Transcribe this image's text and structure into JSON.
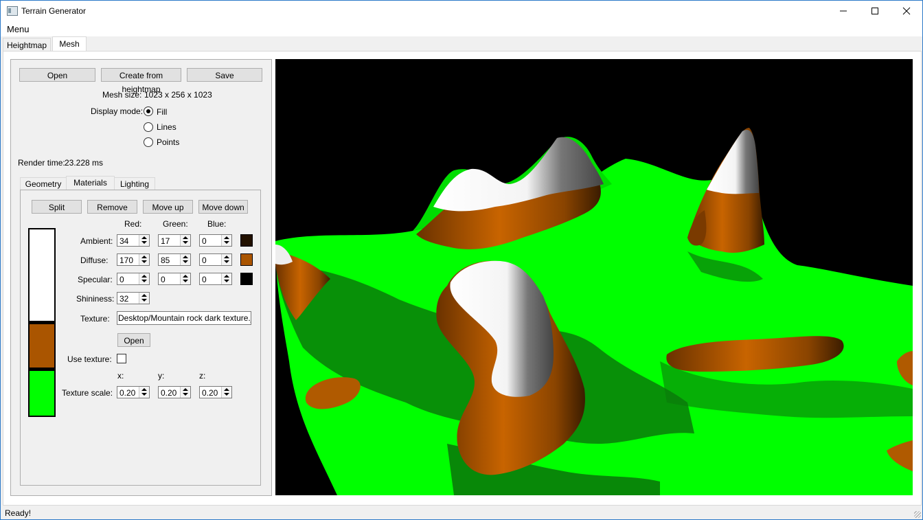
{
  "window": {
    "title": "Terrain Generator"
  },
  "menubar": {
    "menu": "Menu"
  },
  "tabs": [
    {
      "label": "Heightmap"
    },
    {
      "label": "Mesh"
    }
  ],
  "buttons": {
    "open": "Open",
    "create": "Create from heightmap",
    "save": "Save"
  },
  "mesh": {
    "size_label": "Mesh size:",
    "size_value": "1023 x 256 x 1023"
  },
  "display_mode": {
    "label": "Display mode:",
    "options": [
      {
        "label": "Fill",
        "selected": true
      },
      {
        "label": "Lines",
        "selected": false
      },
      {
        "label": "Points",
        "selected": false
      }
    ]
  },
  "render_time": {
    "label": "Render time:",
    "value": "23.228 ms"
  },
  "subtabs": [
    {
      "label": "Geometry"
    },
    {
      "label": "Materials"
    },
    {
      "label": "Lighting"
    }
  ],
  "materials": {
    "buttons": {
      "split": "Split",
      "remove": "Remove",
      "move_up": "Move up",
      "move_down": "Move down"
    },
    "headers": {
      "red": "Red:",
      "green": "Green:",
      "blue": "Blue:"
    },
    "ambient": {
      "label": "Ambient:",
      "r": "34",
      "g": "17",
      "b": "0",
      "color": "#221100"
    },
    "diffuse": {
      "label": "Diffuse:",
      "r": "170",
      "g": "85",
      "b": "0",
      "color": "#aa5500"
    },
    "specular": {
      "label": "Specular:",
      "r": "0",
      "g": "0",
      "b": "0",
      "color": "#000000"
    },
    "shininess": {
      "label": "Shininess:",
      "value": "32"
    },
    "texture": {
      "label": "Texture:",
      "value": "Desktop/Mountain rock dark texture.jpg",
      "open": "Open"
    },
    "use_texture": {
      "label": "Use texture:",
      "checked": false
    },
    "scale_headers": {
      "x": "x:",
      "y": "y:",
      "z": "z:"
    },
    "texture_scale": {
      "label": "Texture scale:",
      "x": "0.20",
      "y": "0.20",
      "z": "0.20"
    },
    "layers": [
      {
        "color": "#ffffff"
      },
      {
        "color": "#aa5500"
      },
      {
        "color": "#00ff00"
      }
    ]
  },
  "status": {
    "text": "Ready!"
  }
}
